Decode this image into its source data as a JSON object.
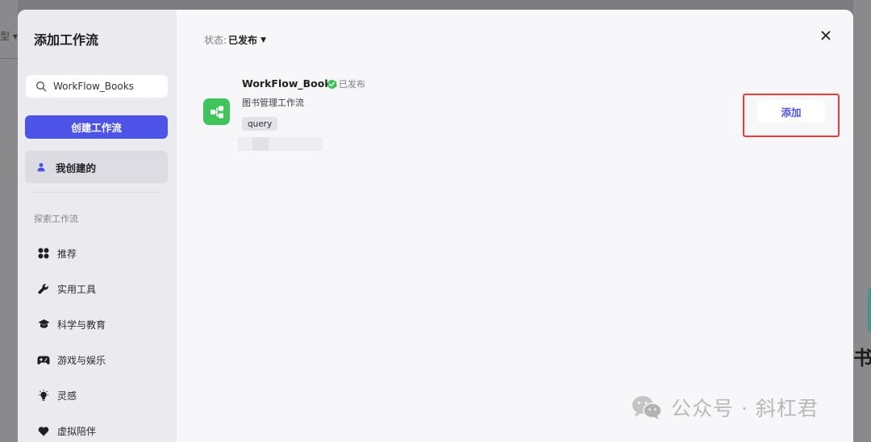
{
  "background": {
    "left_fragment": "型 ▾",
    "right_fragment": "书"
  },
  "modal": {
    "title": "添加工作流",
    "search": {
      "value": "WorkFlow_Books",
      "placeholder": ""
    },
    "create_button": "创建工作流",
    "mine_item": "我创建的",
    "explore_label": "探索工作流",
    "categories": [
      {
        "label": "推荐",
        "icon": "grid-icon"
      },
      {
        "label": "实用工具",
        "icon": "wrench-icon"
      },
      {
        "label": "科学与教育",
        "icon": "graduation-cap-icon"
      },
      {
        "label": "游戏与娱乐",
        "icon": "gamepad-icon"
      },
      {
        "label": "灵感",
        "icon": "lightbulb-icon"
      },
      {
        "label": "虚拟陪伴",
        "icon": "heart-icon"
      }
    ],
    "status_filter": {
      "label": "状态:",
      "value": "已发布"
    },
    "workflow": {
      "name": "WorkFlow_Books",
      "status": "已发布",
      "description": "图书管理工作流",
      "tag": "query",
      "add_button": "添加"
    }
  },
  "watermark": "公众号 · 斜杠君",
  "colors": {
    "accent": "#4e53e8",
    "workflow_icon": "#3ec45b",
    "published_check": "#3ec45b",
    "highlight_outline": "#e63c3c"
  }
}
